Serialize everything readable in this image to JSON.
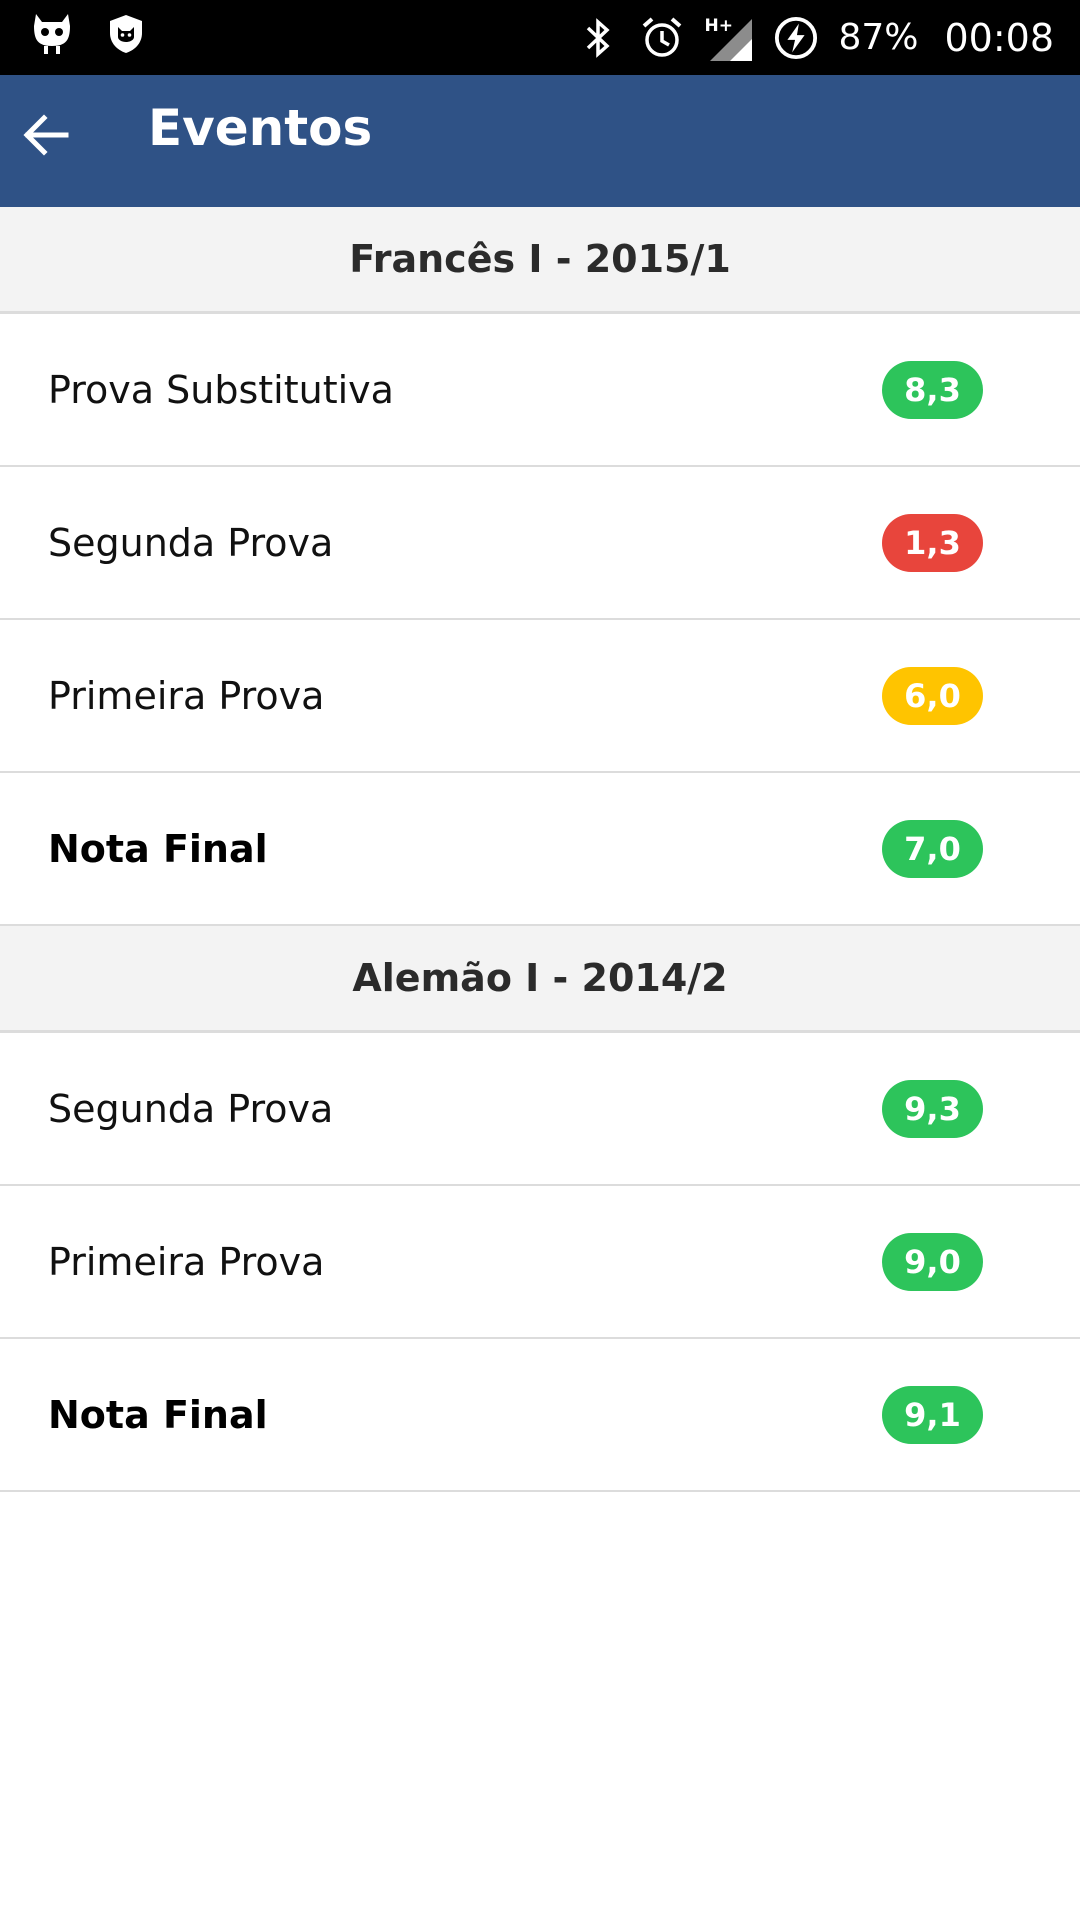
{
  "status_bar": {
    "icons_left": [
      "cyanogen-mascot-icon",
      "shield-icon"
    ],
    "icons_right": [
      "bluetooth-icon",
      "alarm-icon",
      "signal-hplus-icon",
      "battery-charging-icon"
    ],
    "network_label": "H+",
    "battery": "87%",
    "time": "00:08"
  },
  "app_bar": {
    "title": "Eventos",
    "back_icon": "arrow-left-icon",
    "color": "#2f5286"
  },
  "colors": {
    "green": "#2dc45b",
    "red": "#e8453c",
    "yellow": "#ffc400"
  },
  "sections": [
    {
      "title": "Francês I - 2015/1",
      "rows": [
        {
          "label": "Prova Substitutiva",
          "grade": "8,3",
          "status": "green",
          "bold": false
        },
        {
          "label": "Segunda Prova",
          "grade": "1,3",
          "status": "red",
          "bold": false
        },
        {
          "label": "Primeira Prova",
          "grade": "6,0",
          "status": "yellow",
          "bold": false
        },
        {
          "label": "Nota Final",
          "grade": "7,0",
          "status": "green",
          "bold": true
        }
      ]
    },
    {
      "title": "Alemão I - 2014/2",
      "rows": [
        {
          "label": "Segunda Prova",
          "grade": "9,3",
          "status": "green",
          "bold": false
        },
        {
          "label": "Primeira Prova",
          "grade": "9,0",
          "status": "green",
          "bold": false
        },
        {
          "label": "Nota Final",
          "grade": "9,1",
          "status": "green",
          "bold": true
        }
      ]
    }
  ]
}
